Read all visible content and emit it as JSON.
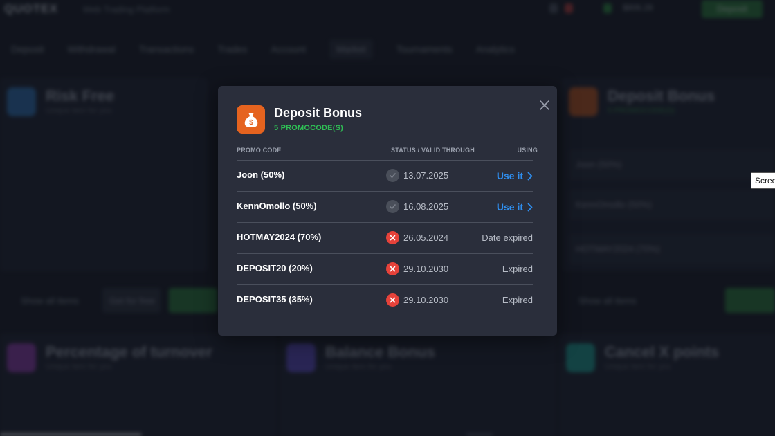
{
  "background": {
    "logo": "QUOTEX",
    "tagline": "Web Trading Platform",
    "balance": "$806.28",
    "deposit_button": "Deposit",
    "tabs": [
      "Deposit",
      "Withdrawal",
      "Transactions",
      "Trades",
      "Account",
      "Market",
      "Tournaments",
      "Analytics"
    ],
    "active_tab": 5,
    "cards": {
      "risk_free": {
        "title": "Risk Free",
        "subtitle": "Unique item for you"
      },
      "deposit_bonus": {
        "title": "Deposit Bonus",
        "subtitle": "5 PROMOCODE(S)"
      },
      "percentage": {
        "title": "Percentage of turnover",
        "subtitle": "Unique item for you"
      },
      "balance_bonus": {
        "title": "Balance Bonus",
        "subtitle": "Unique item for you"
      },
      "cancel_points": {
        "title": "Cancel X points",
        "subtitle": "Unique item for you"
      }
    },
    "show_all_items": "Show all items",
    "get_free": "Get for free",
    "bg_rows": [
      "Joon (50%)",
      "KennOmollo (50%)",
      "HOTMAY2024 (70%)"
    ]
  },
  "modal": {
    "title": "Deposit Bonus",
    "subtitle": "5 PROMOCODE(S)",
    "icon": "money-bag-icon",
    "accent_color": "#e5631f",
    "headers": {
      "code": "PROMO CODE",
      "status": "STATUS / VALID THROUGH",
      "using": "USING"
    },
    "rows": [
      {
        "code": "Joon (50%)",
        "status": "valid",
        "date": "13.07.2025",
        "action": "Use it"
      },
      {
        "code": "KennOmollo (50%)",
        "status": "valid",
        "date": "16.08.2025",
        "action": "Use it"
      },
      {
        "code": "HOTMAY2024 (70%)",
        "status": "invalid",
        "date": "26.05.2024",
        "note": "Date expired"
      },
      {
        "code": "DEPOSIT20 (20%)",
        "status": "invalid",
        "date": "29.10.2030",
        "note": "Expired"
      },
      {
        "code": "DEPOSIT35 (35%)",
        "status": "invalid",
        "date": "29.10.2030",
        "note": "Expired"
      }
    ]
  },
  "tooltip": "Screenshot"
}
